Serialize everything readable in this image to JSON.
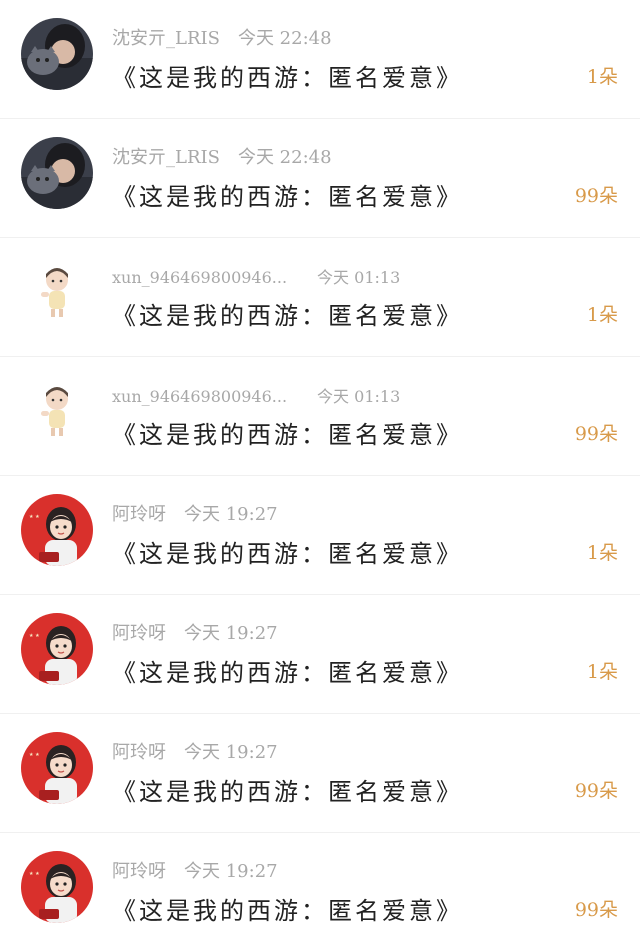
{
  "messages": [
    {
      "avatar": "avatar-photo-cat",
      "user": "沈安亓_LRIS",
      "time": "今天 22:48",
      "title": "《这是我的西游：匿名爱意》",
      "count": "1朵"
    },
    {
      "avatar": "avatar-photo-cat",
      "user": "沈安亓_LRIS",
      "time": "今天 22:48",
      "title": "《这是我的西游：匿名爱意》",
      "count": "99朵"
    },
    {
      "avatar": "avatar-cartoon-child",
      "user": "xun_946469800946...",
      "time": "今天 01:13",
      "title": "《这是我的西游：匿名爱意》",
      "count": "1朵"
    },
    {
      "avatar": "avatar-cartoon-child",
      "user": "xun_946469800946...",
      "time": "今天 01:13",
      "title": "《这是我的西游：匿名爱意》",
      "count": "99朵"
    },
    {
      "avatar": "avatar-cartoon-girl-red",
      "user": "阿玲呀",
      "time": "今天 19:27",
      "title": "《这是我的西游：匿名爱意》",
      "count": "1朵"
    },
    {
      "avatar": "avatar-cartoon-girl-red",
      "user": "阿玲呀",
      "time": "今天 19:27",
      "title": "《这是我的西游：匿名爱意》",
      "count": "1朵"
    },
    {
      "avatar": "avatar-cartoon-girl-red",
      "user": "阿玲呀",
      "time": "今天 19:27",
      "title": "《这是我的西游：匿名爱意》",
      "count": "99朵"
    },
    {
      "avatar": "avatar-cartoon-girl-red",
      "user": "阿玲呀",
      "time": "今天 19:27",
      "title": "《这是我的西游：匿名爱意》",
      "count": "99朵"
    }
  ],
  "colors": {
    "count": "#d89a4a",
    "meta": "#a8a8a8",
    "title": "#222222",
    "avatar_red": "#d9302c"
  }
}
